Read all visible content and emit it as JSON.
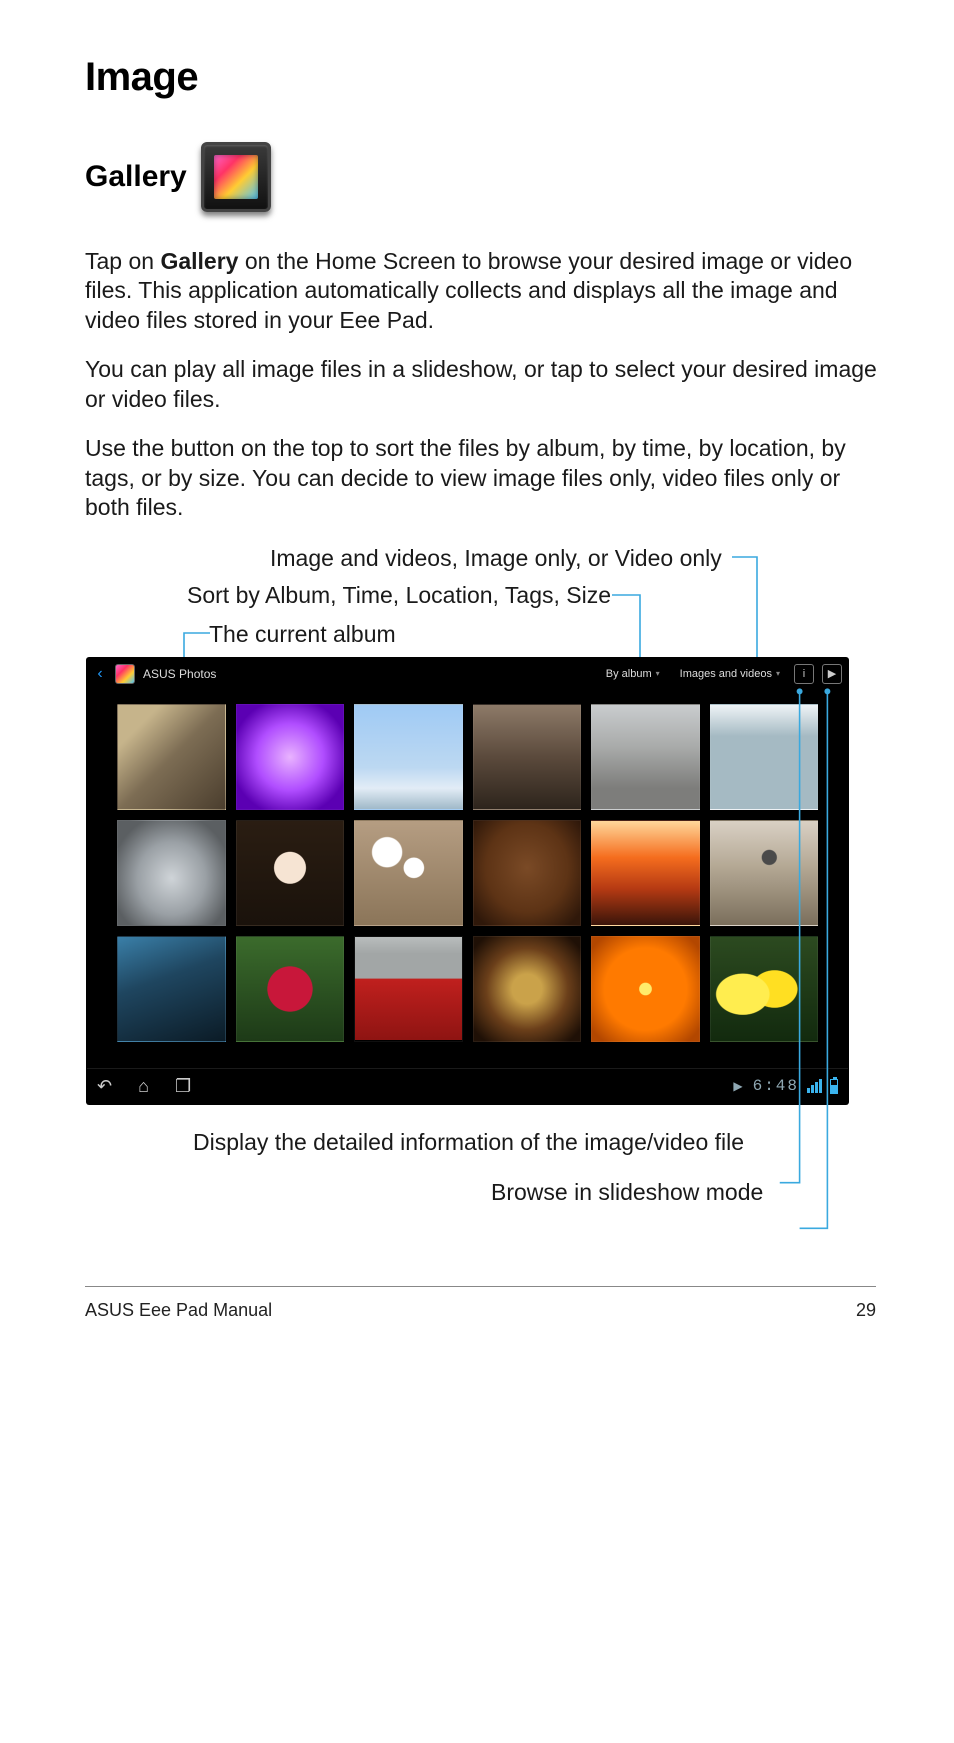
{
  "page": {
    "title": "Image",
    "section": "Gallery",
    "footer_left": "ASUS Eee Pad Manual",
    "footer_right": "29"
  },
  "body": {
    "p1_pre": "Tap on ",
    "p1_bold": "Gallery",
    "p1_post": " on the Home Screen to browse your desired image or video files. This application automatically collects and displays all the image and video files stored in your Eee Pad.",
    "p2": "You can play all image files in a slideshow, or tap to select your desired image or video files.",
    "p3": "Use the button on the top to sort the files by album, by time, by location, by tags, or by size. You can decide to view image files only, video files only or both files."
  },
  "callouts": {
    "top1": "Image and videos, Image only, or Video only",
    "top2": "Sort by Album, Time, Location, Tags, Size",
    "top3": "The current album",
    "bottom1": "Display the detailed information of the image/video file",
    "bottom2": "Browse in slideshow mode"
  },
  "screenshot": {
    "album_name": "ASUS Photos",
    "sort_label": "By album",
    "filter_label": "Images and videos",
    "info_icon": "i",
    "slideshow_icon": "▶",
    "clock": "6:48",
    "nav": {
      "back": "↶",
      "home": "⌂",
      "recent": "❐"
    }
  }
}
